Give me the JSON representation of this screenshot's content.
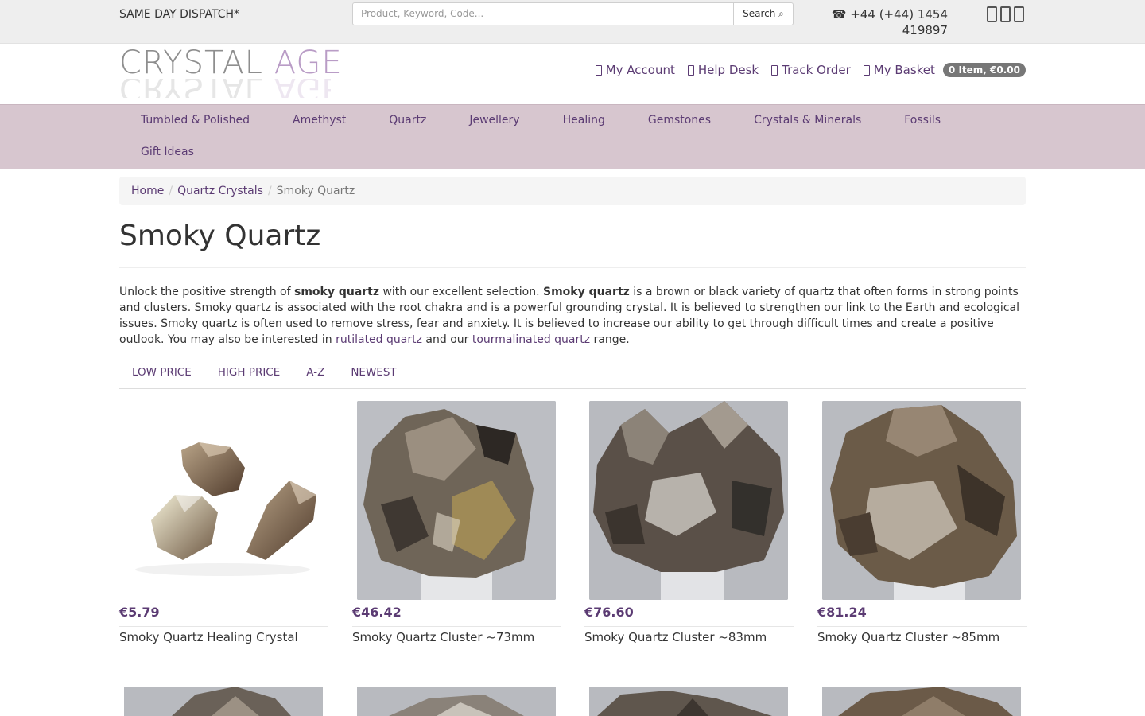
{
  "topbar": {
    "dispatch": "SAME DAY DISPATCH*",
    "search_placeholder": "Product, Keyword, Code...",
    "search_button": "Search",
    "phone_line1": "+44 (+44) 1454",
    "phone_line2": "419897",
    "social_icons": [
      "facebook-icon",
      "twitter-icon",
      "instagram-icon"
    ]
  },
  "header": {
    "logo_word1": "CRYSTAL",
    "logo_word2": "AGE",
    "account": "My Account",
    "helpdesk": "Help Desk",
    "track": "Track Order",
    "basket": "My Basket",
    "basket_badge": "0 Item, €0.00"
  },
  "nav": {
    "items": [
      "Tumbled & Polished",
      "Amethyst",
      "Quartz",
      "Jewellery",
      "Healing",
      "Gemstones",
      "Crystals & Minerals",
      "Fossils",
      "Gift Ideas"
    ]
  },
  "breadcrumb": {
    "home": "Home",
    "parent": "Quartz Crystals",
    "current": "Smoky Quartz"
  },
  "page": {
    "title": "Smoky Quartz",
    "desc_1": "Unlock the positive strength of ",
    "desc_b1": "smoky quartz",
    "desc_2": " with our excellent selection. ",
    "desc_b2": "Smoky quartz",
    "desc_3": " is a brown or black variety of quartz that often forms in strong points and clusters. Smoky quartz is associated with the root chakra and is a powerful grounding crystal. It is believed to strengthen our link to the Earth and ecological issues. Smoky quartz is often used to remove stress, fear and anxiety. It is believed to increase our ability to get through difficult times and create a positive outlook. You may also be interested in ",
    "link1": "rutilated quartz",
    "desc_4": " and our ",
    "link2": "tourmalinated quartz",
    "desc_5": " range."
  },
  "sort": [
    "LOW PRICE",
    "HIGH PRICE",
    "A-Z",
    "NEWEST"
  ],
  "products": [
    {
      "price": "€5.79",
      "name": "Smoky Quartz Healing Crystal"
    },
    {
      "price": "€46.42",
      "name": "Smoky Quartz Cluster ~73mm"
    },
    {
      "price": "€76.60",
      "name": "Smoky Quartz Cluster ~83mm"
    },
    {
      "price": "€81.24",
      "name": "Smoky Quartz Cluster ~85mm"
    }
  ],
  "colors": {
    "accent": "#5b3b73",
    "nav_bg": "#d7c6cf",
    "badge_bg": "#777777"
  }
}
